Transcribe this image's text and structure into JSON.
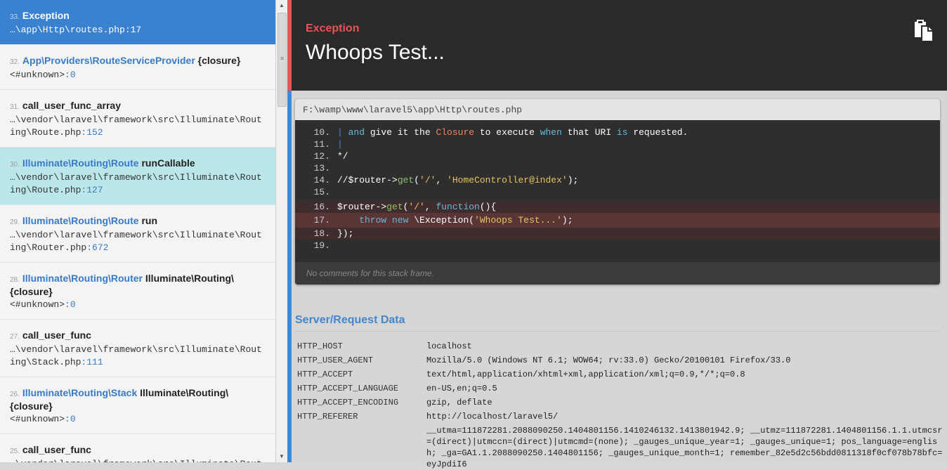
{
  "frames": [
    {
      "index": "33.",
      "class": "Exception",
      "function": "",
      "file": "…\\app\\Http\\routes.php",
      "line": ":17",
      "state": "active"
    },
    {
      "index": "32.",
      "class": "App\\Providers\\RouteServiceProvider",
      "function": "{closure}",
      "file": "<#unknown>",
      "line": ":0",
      "state": ""
    },
    {
      "index": "31.",
      "class": "",
      "function": "call_user_func_array",
      "file": "…\\vendor\\laravel\\framework\\src\\Illuminate\\Routing\\Route.php",
      "line": ":152",
      "state": ""
    },
    {
      "index": "30.",
      "class": "Illuminate\\Routing\\Route",
      "function": "runCallable",
      "file": "…\\vendor\\laravel\\framework\\src\\Illuminate\\Routing\\Route.php",
      "line": ":127",
      "state": "hl"
    },
    {
      "index": "29.",
      "class": "Illuminate\\Routing\\Route",
      "function": "run",
      "file": "…\\vendor\\laravel\\framework\\src\\Illuminate\\Routing\\Router.php",
      "line": ":672",
      "state": ""
    },
    {
      "index": "28.",
      "class": "Illuminate\\Routing\\Router",
      "function": "Illuminate\\Routing\\{closure}",
      "file": "<#unknown>",
      "line": ":0",
      "state": ""
    },
    {
      "index": "27.",
      "class": "",
      "function": "call_user_func",
      "file": "…\\vendor\\laravel\\framework\\src\\Illuminate\\Routing\\Stack.php",
      "line": ":111",
      "state": ""
    },
    {
      "index": "26.",
      "class": "Illuminate\\Routing\\Stack",
      "function": "Illuminate\\Routing\\{closure}",
      "file": "<#unknown>",
      "line": ":0",
      "state": ""
    },
    {
      "index": "25.",
      "class": "",
      "function": "call_user_func",
      "file": "…\\vendor\\laravel\\framework\\src\\Illuminate\\Routing\\Pipeline.php",
      "line": ":",
      "state": ""
    }
  ],
  "header": {
    "exception_class": "Exception",
    "message": "Whoops Test...",
    "copy_icon": "clipboard-icon"
  },
  "code": {
    "file_path": "F:\\wamp\\www\\laravel5\\app\\Http\\routes.php",
    "comments": "No comments for this stack frame."
  },
  "server_data": {
    "title": "Server/Request Data",
    "rows": [
      {
        "key": "HTTP_HOST",
        "value": "localhost"
      },
      {
        "key": "HTTP_USER_AGENT",
        "value": "Mozilla/5.0 (Windows NT 6.1; WOW64; rv:33.0) Gecko/20100101 Firefox/33.0"
      },
      {
        "key": "HTTP_ACCEPT",
        "value": "text/html,application/xhtml+xml,application/xml;q=0.9,*/*;q=0.8"
      },
      {
        "key": "HTTP_ACCEPT_LANGUAGE",
        "value": "en-US,en;q=0.5"
      },
      {
        "key": "HTTP_ACCEPT_ENCODING",
        "value": "gzip, deflate"
      },
      {
        "key": "HTTP_REFERER",
        "value": "http://localhost/laravel5/"
      },
      {
        "key": "",
        "value": "__utma=111872281.2088090250.1404801156.1410246132.1413801942.9; __utmz=111872281.1404801156.1.1.utmcsr=(direct)|utmccn=(direct)|utmcmd=(none); _gauges_unique_year=1; _gauges_unique=1; pos_language=english; _ga=GA1.1.2088090250.1404801156; _gauges_unique_month=1; remember_82e5d2c56bdd0811318f0cf078b78bfc=eyJpdiI6"
      }
    ]
  },
  "colors": {
    "accent_blue": "#4288ce",
    "accent_red": "#e95353",
    "highlight": "#bce7ea"
  }
}
